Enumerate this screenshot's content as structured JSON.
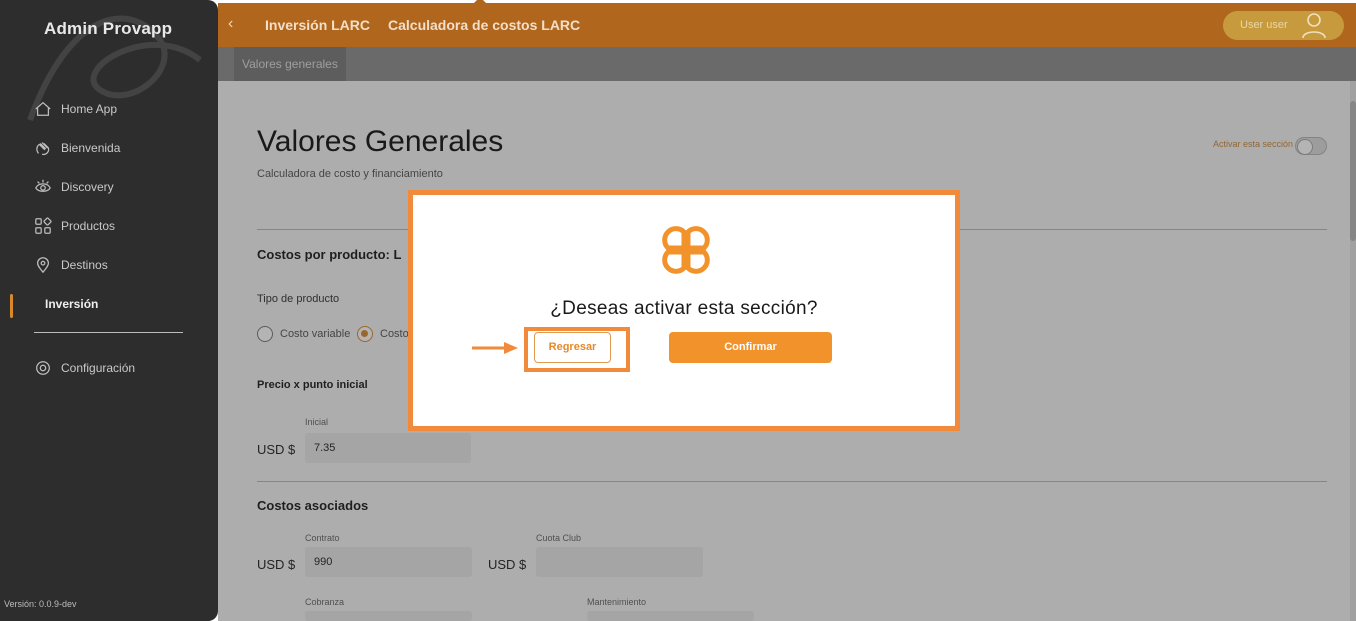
{
  "app": {
    "brand": "Admin Provapp",
    "version": "Versión: 0.0.9-dev"
  },
  "sidebar": {
    "items": [
      {
        "label": "Home App",
        "icon": "home-icon"
      },
      {
        "label": "Bienvenida",
        "icon": "hand-wave-icon"
      },
      {
        "label": "Discovery",
        "icon": "eye-icon"
      },
      {
        "label": "Productos",
        "icon": "grid-icon"
      },
      {
        "label": "Destinos",
        "icon": "map-pin-icon"
      },
      {
        "label": "Inversión",
        "icon": "",
        "active": true
      },
      {
        "label": "Configuración",
        "icon": "gear-icon"
      }
    ]
  },
  "header": {
    "back_icon": "chevron-left-icon",
    "crumbs": [
      "Inversión LARC",
      "Calculadora de costos LARC"
    ],
    "user_label": "User user",
    "user_icon": "user-icon"
  },
  "subnav": {
    "tab": "Valores generales"
  },
  "page": {
    "title": "Valores Generales",
    "subtitle": "Calculadora de costo y financiamiento",
    "toggle_label": "Activar esta sección",
    "section1_title": "Costos por producto: L",
    "tipo_label": "Tipo de producto",
    "radio1": "Costo variable",
    "radio2": "Costo",
    "precio_title": "Precio x punto inicial",
    "inicial_label": "Inicial",
    "currency": "USD $",
    "inicial_value": "7.35",
    "section2_title": "Costos asociados",
    "contrato_label": "Contrato",
    "contrato_value": "990",
    "cuota_label": "Cuota Club",
    "cuota_value": "",
    "cobranza_label": "Cobranza",
    "mantenimiento_label": "Mantenimiento"
  },
  "modal": {
    "question": "¿Deseas activar esta sección?",
    "cancel_label": "Regresar",
    "confirm_label": "Confirmar",
    "logo_icon": "clover-logo-icon",
    "accent": "#f28a3c"
  },
  "colors": {
    "topbar": "#b0661d",
    "sidebar": "#2d2d2d",
    "accent": "#f1922b"
  }
}
